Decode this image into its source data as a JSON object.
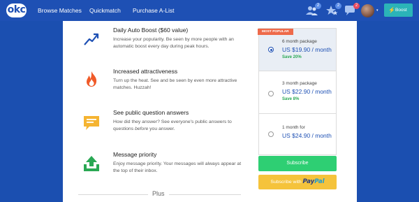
{
  "brand": {
    "logo_text": "okc"
  },
  "nav": {
    "links": [
      "Browse Matches",
      "Quickmatch",
      "Purchase A-List"
    ],
    "likes_count": "2",
    "intros_count": "2",
    "messages_count": "2",
    "boost_label": "Boost"
  },
  "features": [
    {
      "icon": "trending-up-icon",
      "title": "Daily Auto Boost ($60 value)",
      "description": "Increase your popularity. Be seen by more people with an automatic boost every day during peak hours."
    },
    {
      "icon": "flame-icon",
      "title": "Increased attractiveness",
      "description": "Turn up the heat. See and be seen by even more attractive matches. Huzzah!"
    },
    {
      "icon": "chat-bubble-icon",
      "title": "See public question answers",
      "description_parts": [
        "How did they answer? See everyone's public answers to questions ",
        "before",
        " you answer."
      ]
    },
    {
      "icon": "upload-tray-icon",
      "title": "Message priority",
      "description": "Enjoy message priority. Your messages will always appear at the top of their inbox."
    }
  ],
  "plus_label": "Plus",
  "plans": {
    "popular_badge": "MOST POPULAR",
    "options": [
      {
        "name": "6 month package",
        "price": "US $19.90 / month",
        "save": "Save 20%",
        "selected": true
      },
      {
        "name": "3 month package",
        "price": "US $22.90 / month",
        "save": "Save 8%",
        "selected": false
      },
      {
        "name": "1 month for",
        "price": "US $24.90 / month",
        "save": "",
        "selected": false
      }
    ]
  },
  "buttons": {
    "subscribe": "Subscribe",
    "paypal_prefix": "Subscribe with",
    "paypal_pay": "Pay",
    "paypal_pal": "Pal"
  },
  "colors": {
    "topbar": "#1e50b4",
    "backdrop": "#1b4fb0",
    "price": "#1e50b4",
    "save": "#2aa854",
    "subscribe": "#2ecf73",
    "paypal": "#f5c33b",
    "popular": "#ee6a4a",
    "boost": "#2bb4b8"
  }
}
